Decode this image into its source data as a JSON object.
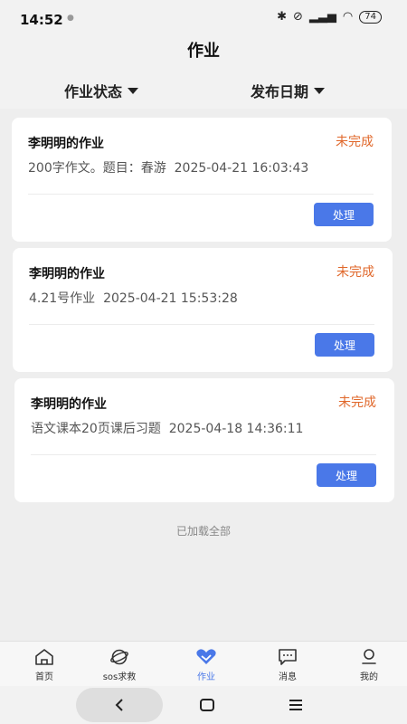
{
  "status_bar": {
    "time": "14:52",
    "battery": "74"
  },
  "header": {
    "title": "作业"
  },
  "filters": {
    "status_label": "作业状态",
    "date_label": "发布日期"
  },
  "assignments": [
    {
      "title": "李明明的作业",
      "status": "未完成",
      "description": "200字作文。题目：春游",
      "datetime": "2025-04-21 16:03:43",
      "action": "处理"
    },
    {
      "title": "李明明的作业",
      "status": "未完成",
      "description": "4.21号作业",
      "datetime": "2025-04-21 15:53:28",
      "action": "处理"
    },
    {
      "title": "李明明的作业",
      "status": "未完成",
      "description": "语文课本20页课后习题",
      "datetime": "2025-04-18 14:36:11",
      "action": "处理"
    }
  ],
  "list_footer": "已加载全部",
  "tab_bar": {
    "items": [
      {
        "label": "首页",
        "icon": "home-icon"
      },
      {
        "label": "sos求救",
        "icon": "sos-icon"
      },
      {
        "label": "作业",
        "icon": "homework-icon",
        "active": true
      },
      {
        "label": "消息",
        "icon": "message-icon"
      },
      {
        "label": "我的",
        "icon": "profile-icon"
      }
    ]
  },
  "colors": {
    "accent": "#4a78e8",
    "status_pending": "#e0672a",
    "background": "#f2f2f2",
    "card": "#ffffff"
  }
}
